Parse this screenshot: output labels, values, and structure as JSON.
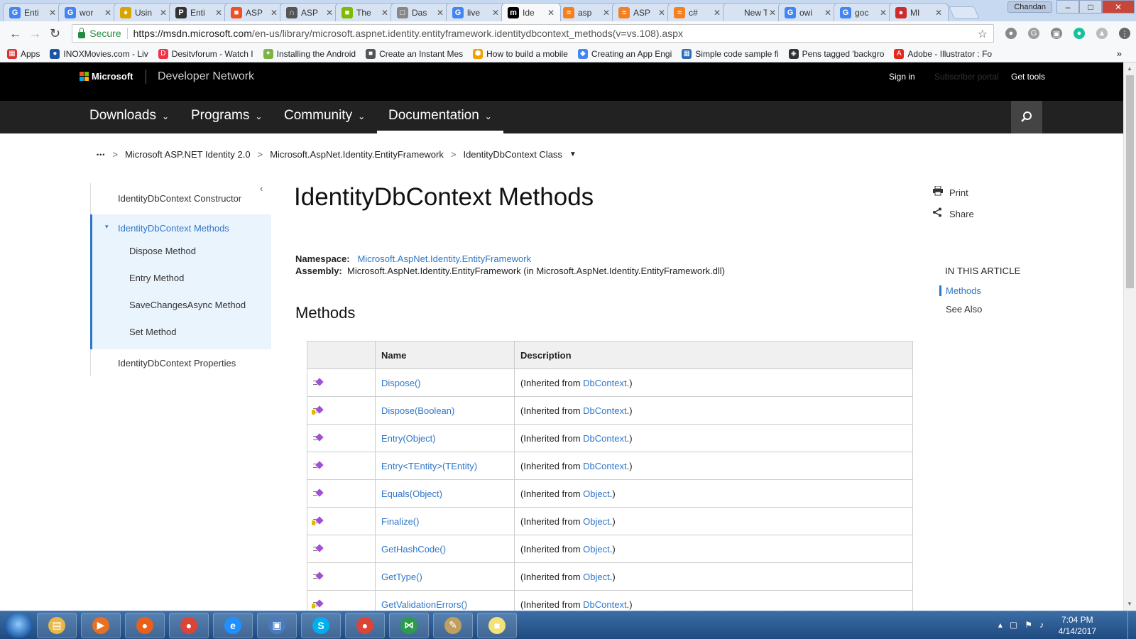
{
  "browser": {
    "tabs": [
      {
        "label": "Enti",
        "fav": "G",
        "color": "#4285f4"
      },
      {
        "label": "wor",
        "fav": "G",
        "color": "#4285f4"
      },
      {
        "label": "Usin",
        "fav": "♦",
        "color": "#d9a400"
      },
      {
        "label": "Enti",
        "fav": "P",
        "color": "#333333"
      },
      {
        "label": "ASP",
        "fav": "■",
        "color": "#f25022"
      },
      {
        "label": "ASP",
        "fav": "∩",
        "color": "#555555"
      },
      {
        "label": "The",
        "fav": "■",
        "color": "#7fba00"
      },
      {
        "label": "Das",
        "fav": "□",
        "color": "#888888"
      },
      {
        "label": "live",
        "fav": "G",
        "color": "#4285f4"
      },
      {
        "label": "Ide",
        "fav": "m",
        "color": "#000000"
      },
      {
        "label": "asp",
        "fav": "≈",
        "color": "#f48024"
      },
      {
        "label": "ASP",
        "fav": "≈",
        "color": "#f48024"
      },
      {
        "label": "c#",
        "fav": "≈",
        "color": "#f48024"
      },
      {
        "label": "New Ta",
        "fav": "",
        "color": ""
      },
      {
        "label": "owi",
        "fav": "G",
        "color": "#4285f4"
      },
      {
        "label": "goc",
        "fav": "G",
        "color": "#4285f4"
      },
      {
        "label": "MI",
        "fav": "●",
        "color": "#d02b2b"
      }
    ],
    "active_tab_index": 9,
    "close_glyph": "✕",
    "window_user": "Chandan",
    "window_buttons": [
      "–",
      "□",
      "✕"
    ],
    "nav": {
      "back": "←",
      "forward": "→",
      "reload": "↻"
    },
    "secure_label": "Secure",
    "url_host": "https://msdn.microsoft.com",
    "url_path": "/en-us/library/microsoft.aspnet.identity.entityframework.identitydbcontext_methods(v=vs.108).aspx",
    "star": "☆",
    "ext_icons": [
      {
        "glyph": "●",
        "color": "#888888"
      },
      {
        "glyph": "G",
        "color": "#9e9e9e"
      },
      {
        "glyph": "▣",
        "color": "#888888"
      },
      {
        "glyph": "●",
        "color": "#15c39a"
      },
      {
        "glyph": "▲",
        "color": "#bbbbbb"
      },
      {
        "glyph": "⋮",
        "color": "#666666"
      }
    ],
    "bookmarks": [
      {
        "label": "Apps",
        "glyph": "▦",
        "color": "#d33"
      },
      {
        "label": "INOXMovies.com - Liv",
        "glyph": "●",
        "color": "#1a56a6"
      },
      {
        "label": "Desitvforum - Watch I",
        "glyph": "D",
        "color": "#e34"
      },
      {
        "label": "Installing the Android",
        "glyph": "✦",
        "color": "#7cb342"
      },
      {
        "label": "Create an Instant Mes",
        "glyph": "■",
        "color": "#555"
      },
      {
        "label": "How to build a mobile",
        "glyph": "⬢",
        "color": "#f0a000"
      },
      {
        "label": "Creating an App Engi",
        "glyph": "◆",
        "color": "#4285f4"
      },
      {
        "label": "Simple code sample fi",
        "glyph": "▦",
        "color": "#2a6ebb"
      },
      {
        "label": "Pens tagged 'backgro",
        "glyph": "◈",
        "color": "#333"
      },
      {
        "label": "Adobe - Illustrator : Fo",
        "glyph": "A",
        "color": "#e4281c"
      }
    ],
    "bookmarks_more": "»"
  },
  "site": {
    "brand": "Microsoft",
    "brand_colors": [
      "#f25022",
      "#7fba00",
      "#00a4ef",
      "#ffb900"
    ],
    "section": "Developer Network",
    "sign_in": "Sign in",
    "subscriber_portal": "Subscriber portal",
    "get_tools": "Get tools",
    "nav": [
      "Downloads",
      "Programs",
      "Community",
      "Documentation"
    ],
    "nav_active_index": 3,
    "nav_chevron": "⌄"
  },
  "breadcrumb": {
    "ellipsis": "•••",
    "sep": ">",
    "items": [
      "Microsoft ASP.NET Identity 2.0",
      "Microsoft.AspNet.Identity.EntityFramework",
      "IdentityDbContext Class"
    ],
    "caret": "▼"
  },
  "leftnav": {
    "collapse": "‹",
    "constructor": "IdentityDbContext Constructor",
    "methods": "IdentityDbContext Methods",
    "expand": "▾",
    "children": [
      "Dispose Method",
      "Entry Method",
      "SaveChangesAsync Method",
      "Set Method"
    ],
    "properties": "IdentityDbContext Properties"
  },
  "article": {
    "title": "IdentityDbContext Methods",
    "namespace_label": "Namespace:",
    "namespace_value": "Microsoft.AspNet.Identity.EntityFramework",
    "assembly_label": "Assembly:",
    "assembly_value": "Microsoft.AspNet.Identity.EntityFramework (in Microsoft.AspNet.Identity.EntityFramework.dll)",
    "methods_heading": "Methods",
    "table": {
      "headers": [
        "",
        "Name",
        "Description"
      ],
      "inherited_prefix": "(Inherited from ",
      "inherited_suffix": ".)",
      "rows": [
        {
          "name": "Dispose()",
          "from": "DbContext",
          "protected": false
        },
        {
          "name": "Dispose(Boolean)",
          "from": "DbContext",
          "protected": true
        },
        {
          "name": "Entry(Object)",
          "from": "DbContext",
          "protected": false
        },
        {
          "name": "Entry<TEntity>(TEntity)",
          "from": "DbContext",
          "protected": false
        },
        {
          "name": "Equals(Object)",
          "from": "Object",
          "protected": false
        },
        {
          "name": "Finalize()",
          "from": "Object",
          "protected": true
        },
        {
          "name": "GetHashCode()",
          "from": "Object",
          "protected": false
        },
        {
          "name": "GetType()",
          "from": "Object",
          "protected": false
        },
        {
          "name": "GetValidationErrors()",
          "from": "DbContext",
          "protected": true
        }
      ]
    }
  },
  "rightrail": {
    "print": "Print",
    "share": "Share",
    "in_this_article": "IN THIS ARTICLE",
    "links": [
      "Methods",
      "See Also"
    ]
  },
  "taskbar": {
    "apps": [
      {
        "name": "explorer",
        "glyph": "▤",
        "color": "#e8b84a"
      },
      {
        "name": "media-player",
        "glyph": "▶",
        "color": "#e87020"
      },
      {
        "name": "firefox",
        "glyph": "●",
        "color": "#e8601c"
      },
      {
        "name": "chrome",
        "glyph": "●",
        "color": "#db4437"
      },
      {
        "name": "internet-explorer",
        "glyph": "e",
        "color": "#1e90ff"
      },
      {
        "name": "network-tool",
        "glyph": "▣",
        "color": "#4a7bc0"
      },
      {
        "name": "skype",
        "glyph": "S",
        "color": "#00aff0"
      },
      {
        "name": "chrome-2",
        "glyph": "●",
        "color": "#db4437"
      },
      {
        "name": "visual-studio",
        "glyph": "⋈",
        "color": "#2a9d4a"
      },
      {
        "name": "paint",
        "glyph": "✎",
        "color": "#c0a060"
      },
      {
        "name": "sticky-notes",
        "glyph": "■",
        "color": "#f3e27a"
      }
    ],
    "tray_icons": [
      "▴",
      "▢",
      "⚑",
      "♪"
    ],
    "time": "7:04 PM",
    "date": "4/14/2017"
  }
}
